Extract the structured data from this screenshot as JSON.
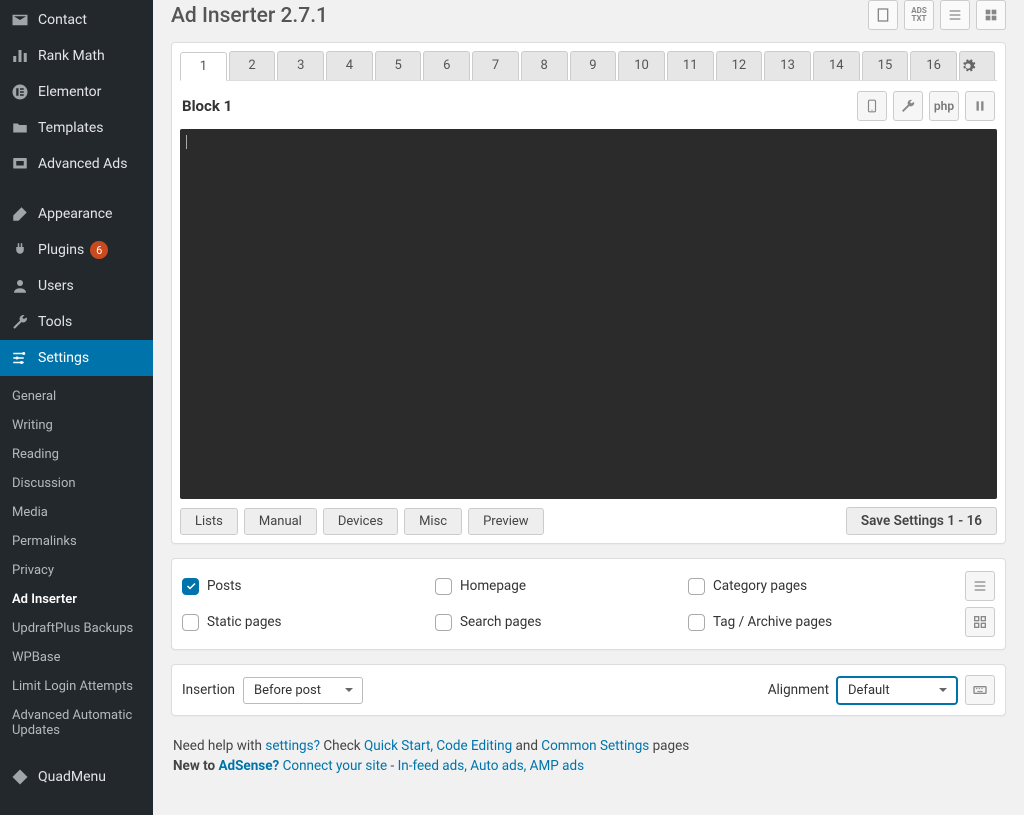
{
  "colors": {
    "accent": "#0073aa",
    "sidebar_bg": "#23282d",
    "editor_bg": "#2b2b2b",
    "badge": "#ca4a1f"
  },
  "sidebar": {
    "top_items": [
      {
        "icon": "mail",
        "label": "Contact"
      },
      {
        "icon": "chart",
        "label": "Rank Math"
      },
      {
        "icon": "elementor",
        "label": "Elementor"
      },
      {
        "icon": "folder",
        "label": "Templates"
      },
      {
        "icon": "ads",
        "label": "Advanced Ads"
      }
    ],
    "admin_items": [
      {
        "icon": "brush",
        "label": "Appearance"
      },
      {
        "icon": "plug",
        "label": "Plugins",
        "badge": "6"
      },
      {
        "icon": "user",
        "label": "Users"
      },
      {
        "icon": "wrench",
        "label": "Tools"
      },
      {
        "icon": "settings",
        "label": "Settings",
        "active": true
      }
    ],
    "settings_sub": [
      "General",
      "Writing",
      "Reading",
      "Discussion",
      "Media",
      "Permalinks",
      "Privacy",
      "Ad Inserter",
      "UpdraftPlus Backups",
      "WPBase",
      "Limit Login Attempts",
      "Advanced Automatic Updates"
    ],
    "settings_sub_active": "Ad Inserter",
    "footer": [
      {
        "icon": "diamond",
        "label": "QuadMenu"
      }
    ]
  },
  "page": {
    "title": "Ad Inserter 2.7.1",
    "top_toolbar": [
      "doc-icon",
      "adstxt-icon",
      "list-icon",
      "grid-icon"
    ]
  },
  "tabs": {
    "numbers": [
      "1",
      "2",
      "3",
      "4",
      "5",
      "6",
      "7",
      "8",
      "9",
      "10",
      "11",
      "12",
      "13",
      "14",
      "15",
      "16"
    ],
    "active": "1"
  },
  "block": {
    "title": "Block 1",
    "icons": [
      "mobile-icon",
      "wrench-icon",
      "php-label",
      "pause-icon"
    ],
    "php_label": "php"
  },
  "actions": {
    "buttons": [
      "Lists",
      "Manual",
      "Devices",
      "Misc",
      "Preview"
    ],
    "save": "Save Settings 1 - 16"
  },
  "placement": {
    "options": [
      {
        "label": "Posts",
        "checked": true
      },
      {
        "label": "Homepage",
        "checked": false
      },
      {
        "label": "Category pages",
        "checked": false
      },
      {
        "label": "Static pages",
        "checked": false
      },
      {
        "label": "Search pages",
        "checked": false
      },
      {
        "label": "Tag / Archive pages",
        "checked": false
      }
    ]
  },
  "insertion": {
    "label": "Insertion",
    "value": "Before post",
    "align_label": "Alignment",
    "align_value": "Default"
  },
  "help": {
    "line1_a": "Need help with ",
    "line1_link1": "settings?",
    "line1_b": " Check ",
    "line1_link2": "Quick Start, Code Editing",
    "line1_c": " and ",
    "line1_link3": "Common Settings",
    "line1_d": " pages",
    "line2_a": "New to ",
    "line2_link1": "AdSense?",
    "line2_b": " ",
    "line2_link2": "Connect your site",
    "line2_c": " - ",
    "line2_link3": "In-feed ads, Auto ads, AMP ads"
  }
}
